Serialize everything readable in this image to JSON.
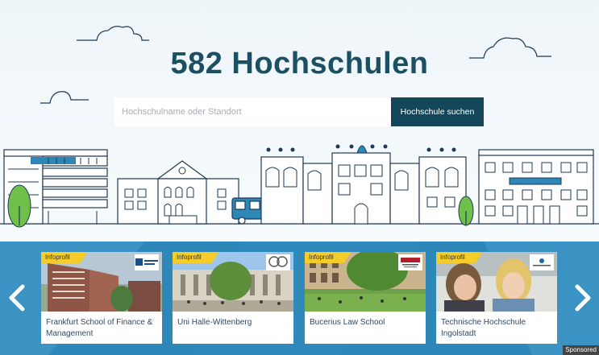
{
  "hero": {
    "title": "582 Hochschulen",
    "search_placeholder": "Hochschulname oder Standort",
    "search_button": "Hochschule suchen"
  },
  "carousel": {
    "cards": [
      {
        "badge": "Infoprofil",
        "name": "Frankfurt School of Finance & Management"
      },
      {
        "badge": "Infoprofil",
        "name": "Uni Halle-Wittenberg"
      },
      {
        "badge": "Infoprofil",
        "name": "Bucerius Law School"
      },
      {
        "badge": "Infoprofil",
        "name": "Technische Hochschule Ingolstadt"
      }
    ],
    "prev_icon": "chevron-left-icon",
    "next_icon": "chevron-right-icon",
    "sponsored_label": "Sponsored"
  },
  "colors": {
    "brand_dark": "#14465a",
    "title": "#1b4f62",
    "carousel_bg": "#2d87b8",
    "badge": "#f5cd2a",
    "line_art": "#1e3a56"
  }
}
